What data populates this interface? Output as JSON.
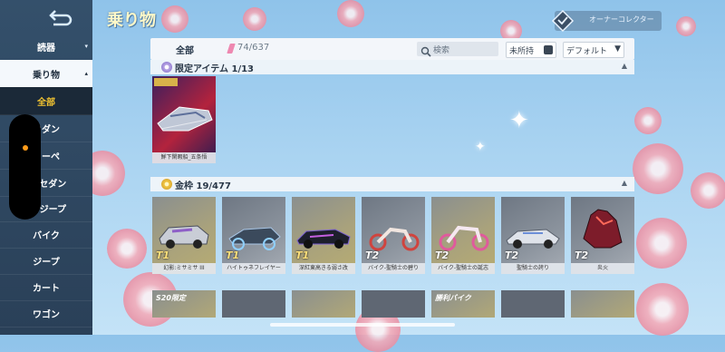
{
  "header": {
    "title": "乗り物",
    "collector_label": "オーナーコレクター"
  },
  "sidebar": {
    "back_icon": "back-arrow-icon",
    "items": [
      {
        "label": "読器",
        "caret": "▾"
      },
      {
        "label": "乗り物",
        "caret": "▴"
      },
      {
        "label": "全部"
      },
      {
        "label": "セダン"
      },
      {
        "label": "クーペ"
      },
      {
        "label": "EVセダン"
      },
      {
        "label": "EVジープ"
      },
      {
        "label": "バイク"
      },
      {
        "label": "ジープ"
      },
      {
        "label": "カート"
      },
      {
        "label": "ワゴン"
      }
    ]
  },
  "filters": {
    "all_label": "全部",
    "count": "74/637",
    "search_placeholder": "検索",
    "owned_label": "未所持",
    "sort_label": "デフォルト",
    "sort_caret": "▼"
  },
  "sections": [
    {
      "label": "限定アイテム 1/13",
      "caret": "▲"
    },
    {
      "label": "金枠 19/477",
      "caret": "▲"
    }
  ],
  "limited_items": [
    {
      "name": "鮮下閑暇船_五条悟"
    }
  ],
  "gold_items": [
    {
      "name": "幻影:ミサミサ III",
      "tier": "T1",
      "style": "gold",
      "badge": ""
    },
    {
      "name": "ハイトゥネフレイヤー",
      "tier": "T1",
      "style": "silver",
      "badge": ""
    },
    {
      "name": "深紅東高きる弱さ改",
      "tier": "T1",
      "style": "gold",
      "badge": ""
    },
    {
      "name": "バイク-聖騎士の碧り",
      "tier": "T2",
      "style": "silver",
      "badge": ""
    },
    {
      "name": "バイク-聖騎士の誕志",
      "tier": "T2",
      "style": "gold",
      "badge": ""
    },
    {
      "name": "聖騎士の誇り",
      "tier": "T2",
      "style": "silver",
      "badge": ""
    },
    {
      "name": "炎火",
      "tier": "T2",
      "style": "silver",
      "badge": ""
    }
  ],
  "partial_row": [
    {
      "label": "S20限定"
    },
    {
      "label": ""
    },
    {
      "label": ""
    },
    {
      "label": ""
    },
    {
      "label": "勝利バイク"
    },
    {
      "label": ""
    },
    {
      "label": ""
    }
  ],
  "colors": {
    "accent": "#f3c431",
    "sidebar_bg": "#2f4862",
    "title": "#fff8c8"
  }
}
